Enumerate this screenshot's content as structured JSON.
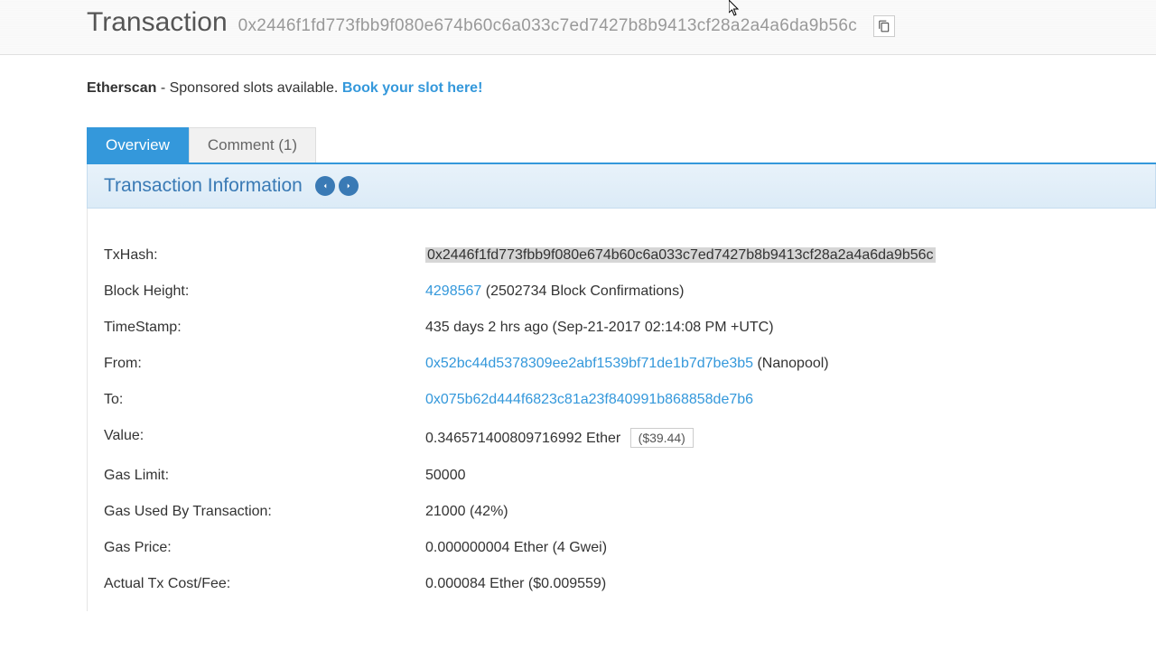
{
  "header": {
    "title": "Transaction",
    "hash": "0x2446f1fd773fbb9f080e674b60c6a033c7ed7427b8b9413cf28a2a4a6da9b56c"
  },
  "sponsor": {
    "site": "Etherscan",
    "text": " - Sponsored slots available. ",
    "link_text": "Book your slot here!"
  },
  "tabs": {
    "overview": "Overview",
    "comment": "Comment (1)"
  },
  "panel": {
    "title": "Transaction Information"
  },
  "fields": {
    "txhash_label": "TxHash:",
    "txhash_value": "0x2446f1fd773fbb9f080e674b60c6a033c7ed7427b8b9413cf28a2a4a6da9b56c",
    "blockheight_label": "Block Height:",
    "block_link": "4298567",
    "block_conf": " (2502734 Block Confirmations)",
    "timestamp_label": "TimeStamp:",
    "timestamp_value": "435 days 2 hrs ago (Sep-21-2017 02:14:08 PM +UTC)",
    "from_label": "From:",
    "from_link": "0x52bc44d5378309ee2abf1539bf71de1b7d7be3b5",
    "from_suffix": " (Nanopool)",
    "to_label": "To:",
    "to_link": "0x075b62d444f6823c81a23f840991b868858de7b6",
    "value_label": "Value:",
    "value_eth": "0.346571400809716992 Ether",
    "value_usd": "($39.44)",
    "gaslimit_label": "Gas Limit:",
    "gaslimit_value": "50000",
    "gasused_label": "Gas Used By Transaction:",
    "gasused_value": "21000 (42%)",
    "gasprice_label": "Gas Price:",
    "gasprice_value": "0.000000004 Ether (4 Gwei)",
    "txcost_label": "Actual Tx Cost/Fee:",
    "txcost_value": "0.000084 Ether ($0.009559)"
  }
}
